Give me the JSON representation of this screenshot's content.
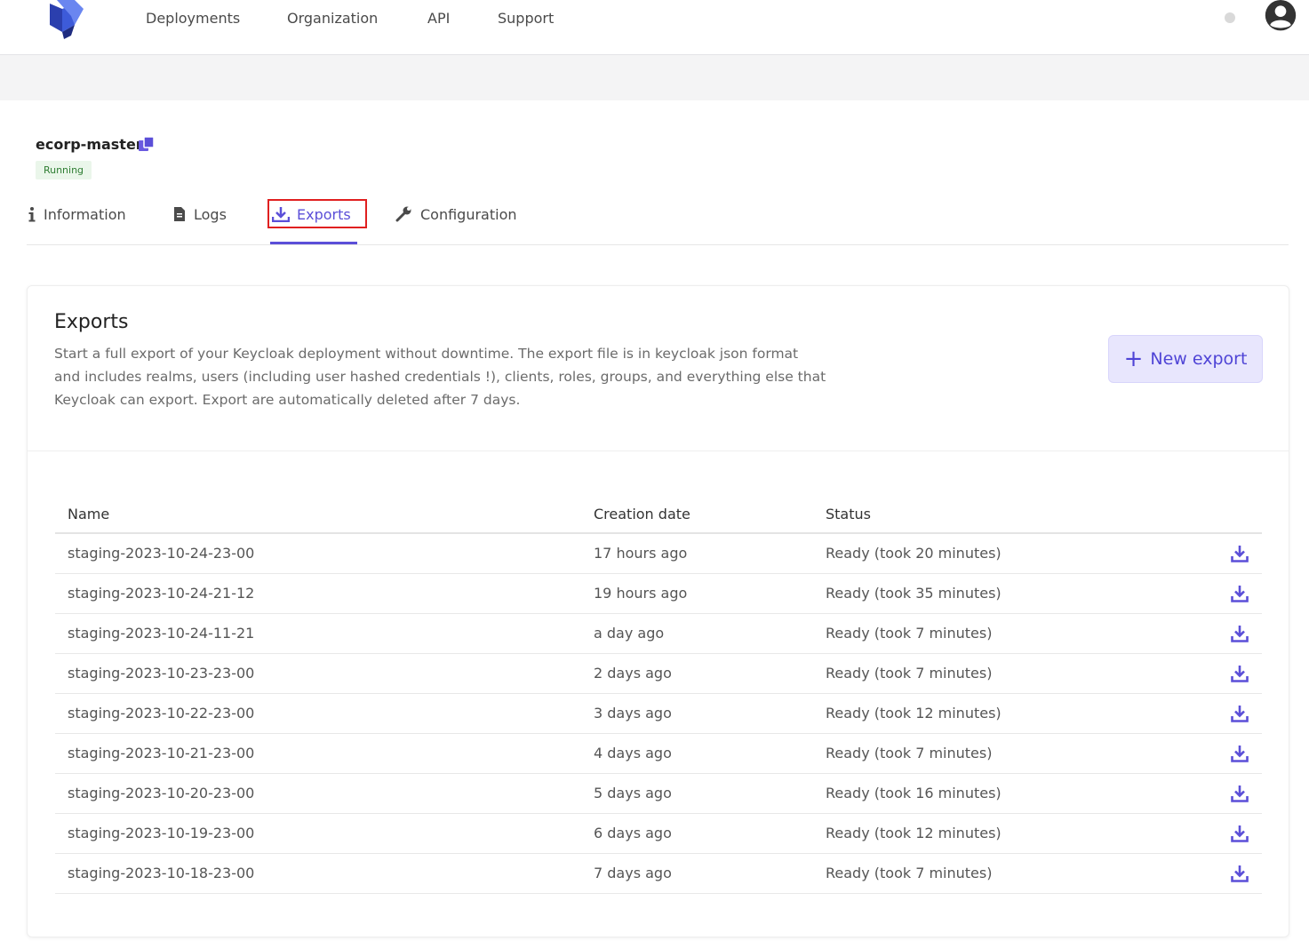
{
  "nav": {
    "items": [
      {
        "label": "Deployments"
      },
      {
        "label": "Organization"
      },
      {
        "label": "API"
      },
      {
        "label": "Support"
      }
    ]
  },
  "deployment": {
    "name": "ecorp-master",
    "status": "Running"
  },
  "tabs": [
    {
      "label": "Information",
      "icon": "info-icon"
    },
    {
      "label": "Logs",
      "icon": "file-icon"
    },
    {
      "label": "Exports",
      "icon": "download-icon",
      "active": true
    },
    {
      "label": "Configuration",
      "icon": "wrench-icon"
    }
  ],
  "exports": {
    "title": "Exports",
    "description": "Start a full export of your Keycloak deployment without downtime. The export file is in keycloak json format and includes realms, users (including user hashed credentials !), clients, roles, groups, and everything else that Keycloak can export. Export are automatically deleted after 7 days.",
    "new_button": "New export",
    "columns": {
      "name": "Name",
      "date": "Creation date",
      "status": "Status"
    },
    "rows": [
      {
        "name": "staging-2023-10-24-23-00",
        "date": "17 hours ago",
        "status": "Ready (took 20 minutes)"
      },
      {
        "name": "staging-2023-10-24-21-12",
        "date": "19 hours ago",
        "status": "Ready (took 35 minutes)"
      },
      {
        "name": "staging-2023-10-24-11-21",
        "date": "a day ago",
        "status": "Ready (took 7 minutes)"
      },
      {
        "name": "staging-2023-10-23-23-00",
        "date": "2 days ago",
        "status": "Ready (took 7 minutes)"
      },
      {
        "name": "staging-2023-10-22-23-00",
        "date": "3 days ago",
        "status": "Ready (took 12 minutes)"
      },
      {
        "name": "staging-2023-10-21-23-00",
        "date": "4 days ago",
        "status": "Ready (took 7 minutes)"
      },
      {
        "name": "staging-2023-10-20-23-00",
        "date": "5 days ago",
        "status": "Ready (took 16 minutes)"
      },
      {
        "name": "staging-2023-10-19-23-00",
        "date": "6 days ago",
        "status": "Ready (took 12 minutes)"
      },
      {
        "name": "staging-2023-10-18-23-00",
        "date": "7 days ago",
        "status": "Ready (took 7 minutes)"
      }
    ]
  },
  "colors": {
    "accent": "#5b4fd8",
    "highlight": "#e02020"
  }
}
